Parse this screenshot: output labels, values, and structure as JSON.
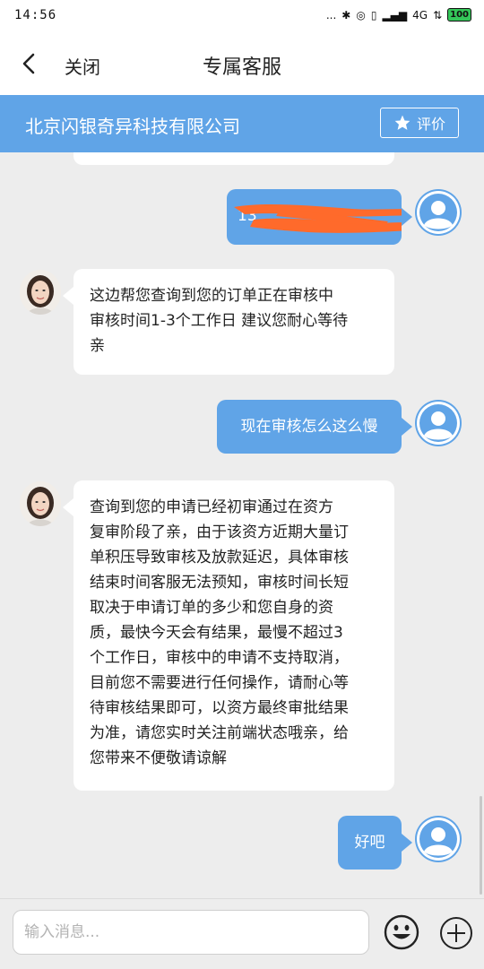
{
  "status": {
    "time": "14:56",
    "dots": "...",
    "network": "4G",
    "battery": "100"
  },
  "titlebar": {
    "close_label": "关闭",
    "title": "专属客服"
  },
  "company": {
    "name": "北京闪银奇异科技有限公司",
    "rate_label": "评价"
  },
  "messages": [
    {
      "from": "user",
      "text": "13"
    },
    {
      "from": "agent",
      "lines": [
        "这边帮您查询到您的订单正在审核中",
        "审核时间1-3个工作日 建议您耐心等待",
        "亲"
      ]
    },
    {
      "from": "user",
      "text": "现在审核怎么这么慢"
    },
    {
      "from": "agent",
      "lines": [
        "查询到您的申请已经初审通过在资方",
        "复审阶段了亲，由于该资方近期大量订",
        "单积压导致审核及放款延迟，具体审核",
        "结束时间客服无法预知，审核时间长短",
        "取决于申请订单的多少和您自身的资",
        "质，最快今天会有结果，最慢不超过3",
        "个工作日，审核中的申请不支持取消，",
        "目前您不需要进行任何操作，请耐心等",
        "待审核结果即可，以资方最终审批结果",
        "为准，请您实时关注前端状态哦亲，给",
        "您带来不便敬请谅解"
      ]
    },
    {
      "from": "user",
      "text": "好吧"
    }
  ],
  "input": {
    "placeholder": "输入消息..."
  },
  "colors": {
    "accent": "#60a4e7",
    "background": "#ededed",
    "redaction": "#ff6a2b"
  }
}
